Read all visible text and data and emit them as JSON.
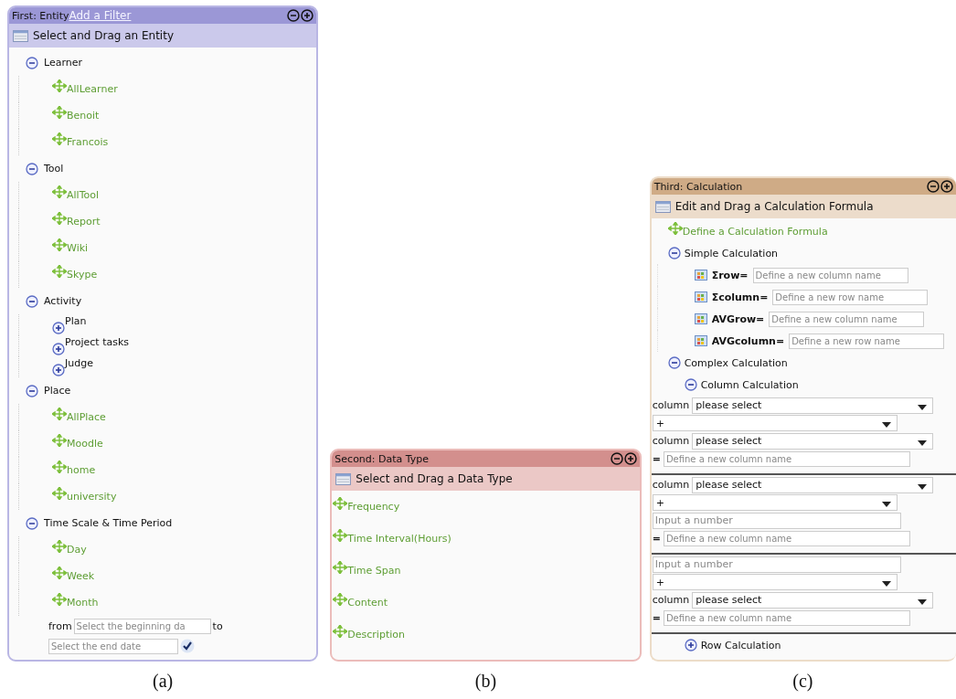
{
  "panels": [
    {
      "kind": "entity",
      "title": "First: Entity",
      "link": "Add a Filter",
      "header": "Select and Drag an Entity",
      "caption": "(a)",
      "groups": [
        {
          "label": "Learner",
          "expanded": true,
          "children": [
            {
              "kind": "leaf",
              "label": "AllLearner"
            },
            {
              "kind": "leaf",
              "label": "Benoit"
            },
            {
              "kind": "leaf",
              "label": "Francois"
            }
          ]
        },
        {
          "label": "Tool",
          "expanded": true,
          "children": [
            {
              "kind": "leaf",
              "label": "AllTool"
            },
            {
              "kind": "leaf",
              "label": "Report"
            },
            {
              "kind": "leaf",
              "label": "Wiki"
            },
            {
              "kind": "leaf",
              "label": "Skype"
            }
          ]
        },
        {
          "label": "Activity",
          "expanded": true,
          "children": [
            {
              "kind": "node",
              "label": "Plan",
              "expanded": false
            },
            {
              "kind": "node",
              "label": "Project tasks",
              "expanded": false
            },
            {
              "kind": "node",
              "label": "Judge",
              "expanded": false
            }
          ]
        },
        {
          "label": "Place",
          "expanded": true,
          "children": [
            {
              "kind": "leaf",
              "label": "AllPlace"
            },
            {
              "kind": "leaf",
              "label": "Moodle"
            },
            {
              "kind": "leaf",
              "label": "home"
            },
            {
              "kind": "leaf",
              "label": "university"
            }
          ]
        },
        {
          "label": "Time Scale & Time Period",
          "expanded": true,
          "children": [
            {
              "kind": "leaf",
              "label": "Day"
            },
            {
              "kind": "leaf",
              "label": "Week"
            },
            {
              "kind": "leaf",
              "label": "Month"
            }
          ]
        }
      ],
      "date_range": {
        "from_label": "from",
        "from_placeholder": "Select the beginning da",
        "to_label": "to",
        "to_placeholder": "Select the end date"
      }
    },
    {
      "kind": "datatype",
      "title": "Second: Data Type",
      "header": "Select and Drag a Data Type",
      "caption": "(b)",
      "items": [
        "Frequency",
        "Time Interval(Hours)",
        "Time Span",
        "Content",
        "Description"
      ]
    },
    {
      "kind": "calculation",
      "title": "Third: Calculation",
      "header": "Edit and Drag a Calculation Formula",
      "caption": "(c)",
      "formula": "Define a Calculation Formula",
      "simple": {
        "label": "Simple Calculation",
        "expanded": true,
        "items": [
          {
            "label": "Σrow=",
            "placeholder": "Define a new column name"
          },
          {
            "label": "Σcolumn=",
            "placeholder": "Define a new row name"
          },
          {
            "label": "AVGrow=",
            "placeholder": "Define a new column name"
          },
          {
            "label": "AVGcolumn=",
            "placeholder": "Define a new row name"
          }
        ]
      },
      "complex": {
        "label": "Complex Calculation",
        "expanded": true,
        "children": [
          {
            "label": "Column Calculation",
            "expanded": true,
            "blocks": [
              [
                {
                  "kind": "select",
                  "label": "column",
                  "value": "please select"
                },
                {
                  "kind": "select",
                  "value": "+"
                },
                {
                  "kind": "select",
                  "label": "column",
                  "value": "please select"
                },
                {
                  "kind": "result",
                  "prefix": "=",
                  "placeholder": "Define a new column name"
                }
              ],
              [
                {
                  "kind": "select",
                  "label": "column",
                  "value": "please select"
                },
                {
                  "kind": "select",
                  "value": "+"
                },
                {
                  "kind": "number",
                  "placeholder": "Input a number"
                },
                {
                  "kind": "result",
                  "prefix": "=",
                  "placeholder": "Define a new column name"
                }
              ],
              [
                {
                  "kind": "number",
                  "placeholder": "Input a number"
                },
                {
                  "kind": "select",
                  "value": "+"
                },
                {
                  "kind": "select",
                  "label": "column",
                  "value": "please select"
                },
                {
                  "kind": "result",
                  "prefix": "=",
                  "placeholder": "Define a new column name"
                }
              ]
            ]
          },
          {
            "label": "Row Calculation",
            "expanded": false
          }
        ]
      }
    }
  ]
}
